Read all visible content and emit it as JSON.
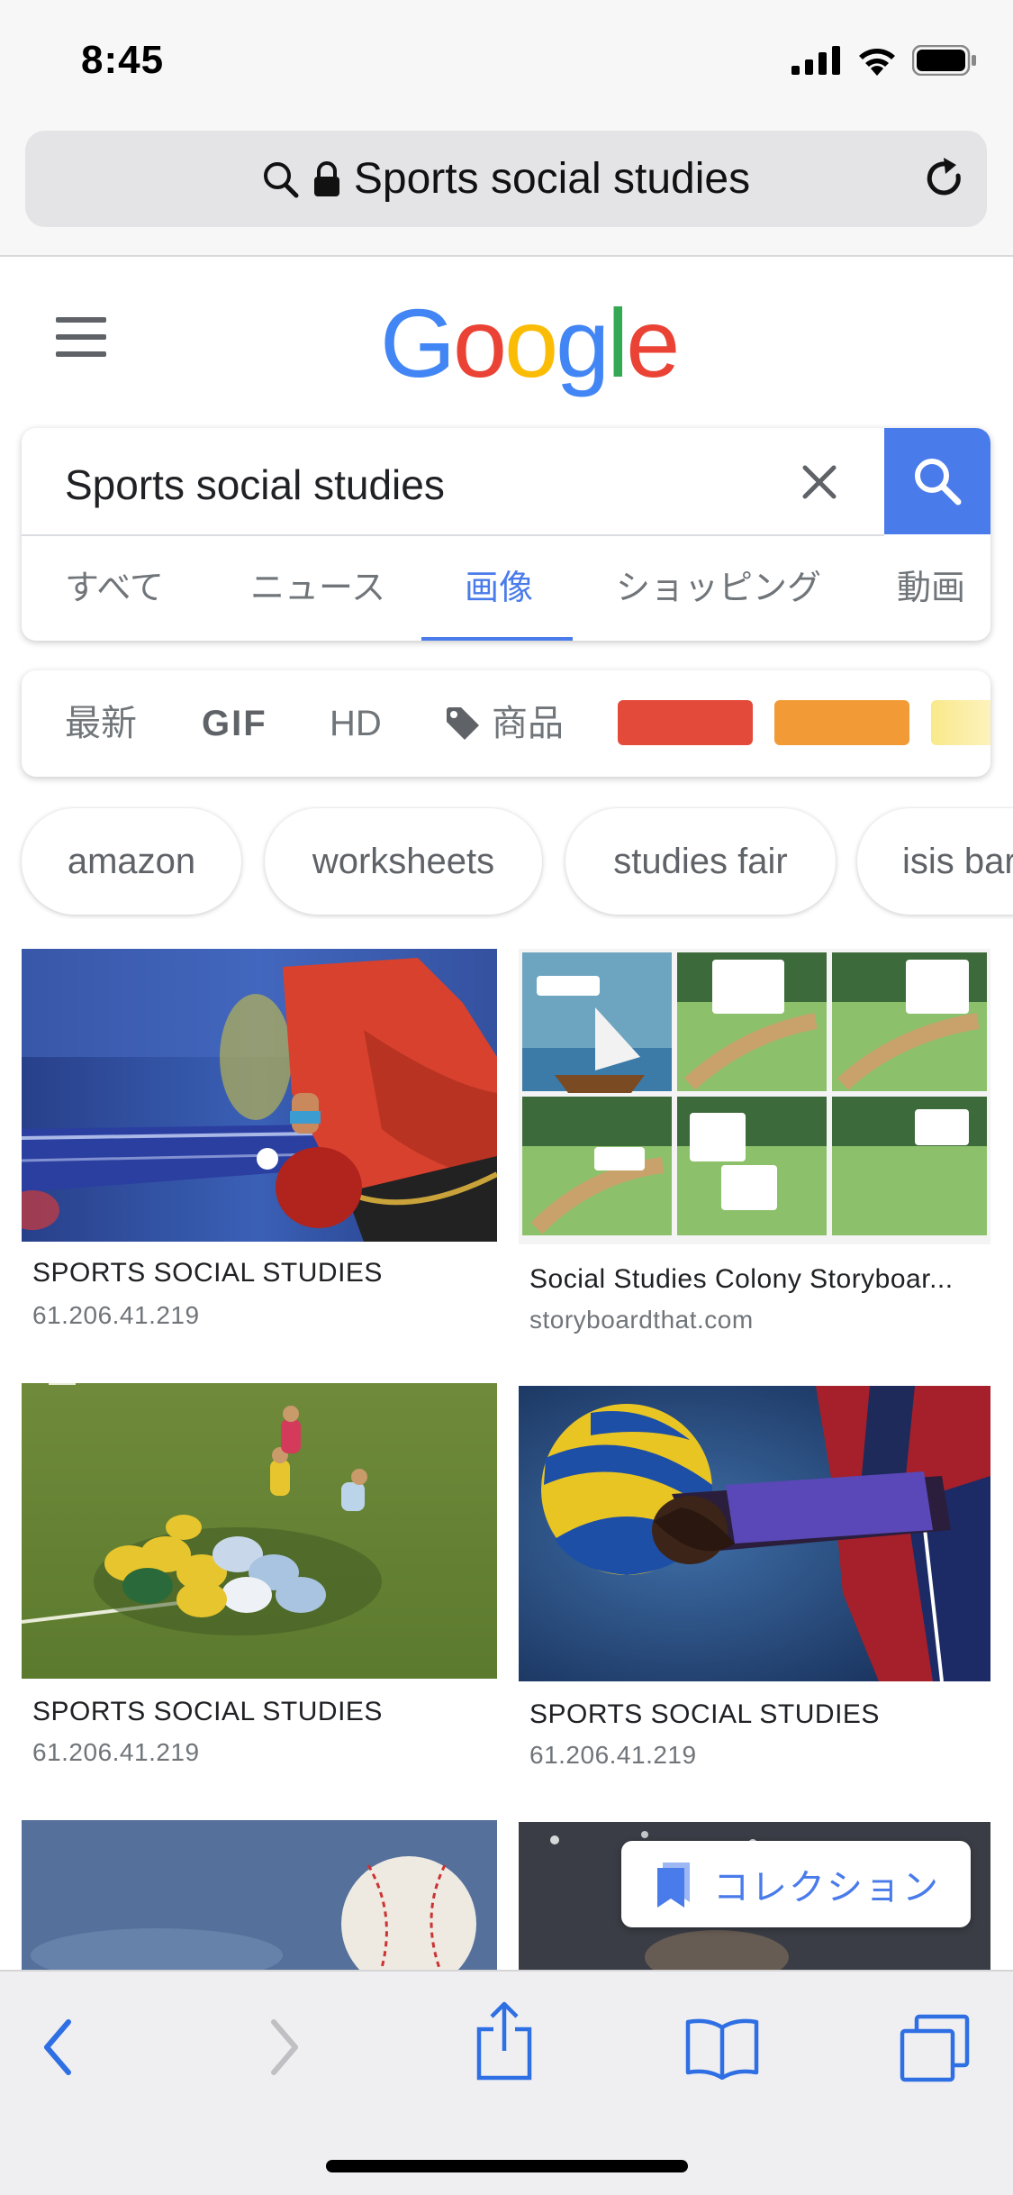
{
  "status_bar": {
    "time": "8:45"
  },
  "browser": {
    "url_text": "Sports social studies"
  },
  "google": {
    "logo_letters": [
      "G",
      "o",
      "o",
      "g",
      "l",
      "e"
    ],
    "logo_colors": [
      "#4285f4",
      "#ea4335",
      "#fbbc05",
      "#4285f4",
      "#34a853",
      "#ea4335"
    ],
    "search_value": "Sports social studies",
    "accent": "#4a7bea",
    "tabs": [
      {
        "label": "すべて"
      },
      {
        "label": "ニュース"
      },
      {
        "label": "画像",
        "active": true
      },
      {
        "label": "ショッピング"
      },
      {
        "label": "動画"
      }
    ]
  },
  "filters": {
    "recent": "最新",
    "gif": "GIF",
    "hd": "HD",
    "products": "商品",
    "color_swatches": [
      "#e34a3a",
      "#f29a36",
      "#f8e98a"
    ]
  },
  "chips": [
    "amazon",
    "worksheets",
    "studies fair",
    "isis bar"
  ],
  "results": [
    {
      "title": "SPORTS SOCIAL STUDIES",
      "source": "61.206.41.219"
    },
    {
      "title": "Social Studies Colony Storyboar...",
      "source": "storyboardthat.com"
    },
    {
      "title": "SPORTS SOCIAL STUDIES",
      "source": "61.206.41.219"
    },
    {
      "title": "SPORTS SOCIAL STUDIES",
      "source": "61.206.41.219"
    }
  ],
  "collection_button": {
    "label": "コレクション"
  }
}
